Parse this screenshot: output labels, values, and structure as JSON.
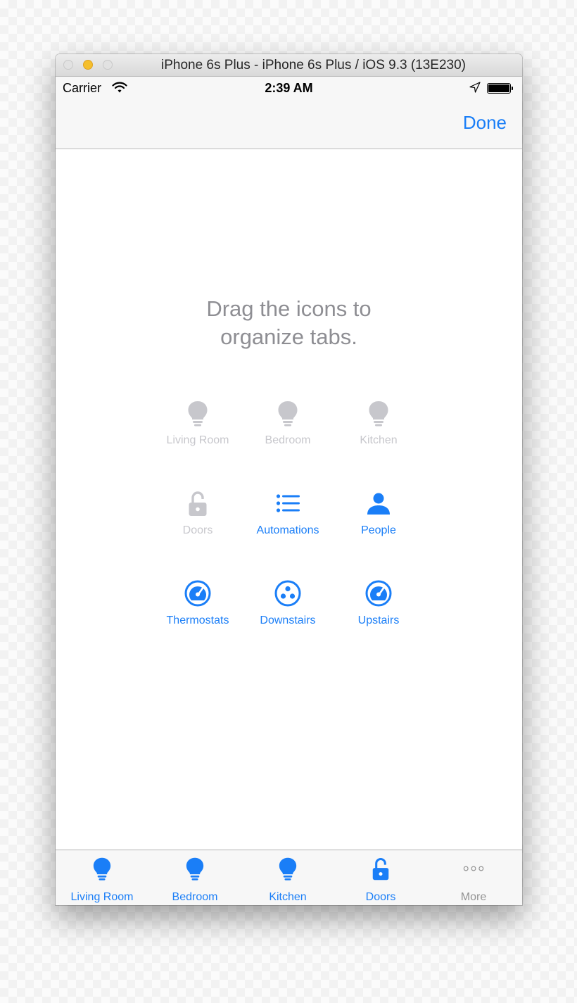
{
  "window": {
    "title": "iPhone 6s Plus - iPhone 6s Plus / iOS 9.3 (13E230)"
  },
  "status_bar": {
    "carrier": "Carrier",
    "time": "2:39 AM"
  },
  "nav_bar": {
    "done_label": "Done"
  },
  "instruction": {
    "line1": "Drag the icons to",
    "line2": "organize tabs."
  },
  "grid": [
    {
      "label": "Living Room",
      "icon": "lightbulb-icon",
      "state": "in-tab-bar"
    },
    {
      "label": "Bedroom",
      "icon": "lightbulb-icon",
      "state": "in-tab-bar"
    },
    {
      "label": "Kitchen",
      "icon": "lightbulb-icon",
      "state": "in-tab-bar"
    },
    {
      "label": "Doors",
      "icon": "lock-icon",
      "state": "in-tab-bar"
    },
    {
      "label": "Automations",
      "icon": "list-icon",
      "state": "available"
    },
    {
      "label": "People",
      "icon": "person-icon",
      "state": "available"
    },
    {
      "label": "Thermostats",
      "icon": "gauge-icon",
      "state": "available"
    },
    {
      "label": "Downstairs",
      "icon": "three-dots-circle-icon",
      "state": "available"
    },
    {
      "label": "Upstairs",
      "icon": "gauge-icon",
      "state": "available"
    }
  ],
  "tab_bar": [
    {
      "label": "Living Room",
      "icon": "lightbulb-icon"
    },
    {
      "label": "Bedroom",
      "icon": "lightbulb-icon"
    },
    {
      "label": "Kitchen",
      "icon": "lightbulb-icon"
    },
    {
      "label": "Doors",
      "icon": "lock-icon"
    },
    {
      "label": "More",
      "icon": "more-dots-icon"
    }
  ],
  "colors": {
    "accent": "#1a7ef7",
    "inactive": "#c7c7cc",
    "instruction_text": "#8e8e93",
    "bar_background": "#f7f7f7"
  }
}
